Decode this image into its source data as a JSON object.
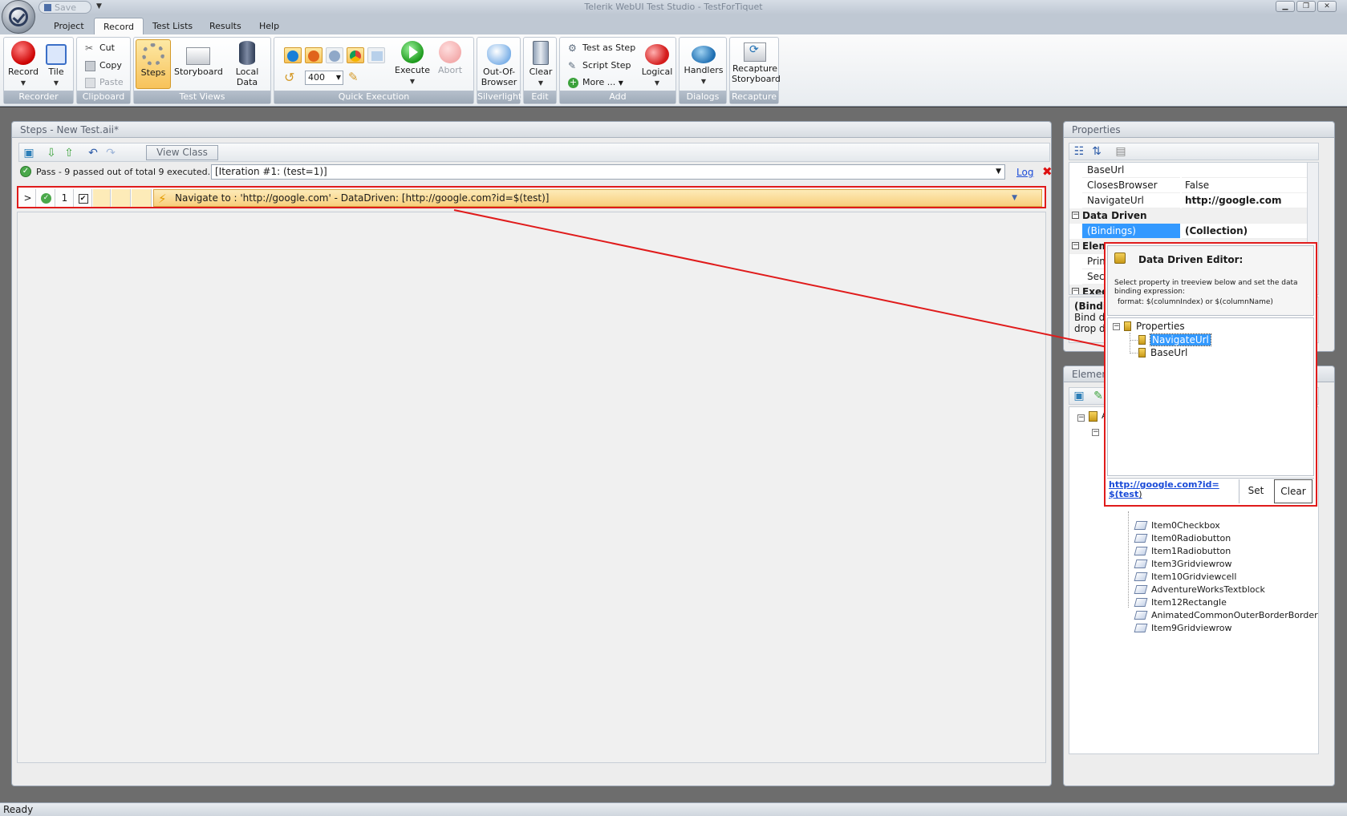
{
  "window": {
    "title": "Telerik WebUI Test Studio - TestForTiquet",
    "qat_save": "Save"
  },
  "tabs": [
    "Project",
    "Record",
    "Test Lists",
    "Results",
    "Help"
  ],
  "ribbon": {
    "recorder": {
      "label": "Recorder",
      "record": "Record",
      "tile": "Tile"
    },
    "clipboard": {
      "label": "Clipboard",
      "cut": "Cut",
      "copy": "Copy",
      "paste": "Paste"
    },
    "test_views": {
      "label": "Test Views",
      "steps": "Steps",
      "storyboard": "Storyboard",
      "local_data": "Local Data"
    },
    "quick_execution": {
      "label": "Quick Execution",
      "speed": "400",
      "execute": "Execute",
      "abort": "Abort"
    },
    "silverlight": {
      "label": "Silverlight",
      "oob_1": "Out-Of-",
      "oob_2": "Browser"
    },
    "edit": {
      "label": "Edit",
      "clear": "Clear"
    },
    "add": {
      "label": "Add",
      "test_as_step": "Test as Step",
      "script_step": "Script Step",
      "more": "More ...",
      "logical": "Logical"
    },
    "dialogs": {
      "label": "Dialogs",
      "handlers": "Handlers"
    },
    "recapture": {
      "label": "Recapture",
      "recapture_1": "Recapture",
      "recapture_2": "Storyboard"
    }
  },
  "steps_panel": {
    "title": "Steps - New Test.aii*",
    "view_class": "View Class",
    "status": "Pass - 9 passed out of total 9 executed.",
    "iteration": "[Iteration #1: (test=1)]",
    "log": "Log",
    "step": {
      "expander": ">",
      "number": "1",
      "description": "Navigate to : 'http://google.com' - DataDriven: [http://google.com?id=$(test)]"
    }
  },
  "properties_panel": {
    "title": "Properties",
    "rows": [
      {
        "key": "BaseUrl",
        "value": ""
      },
      {
        "key": "ClosesBrowser",
        "value": "False"
      },
      {
        "key": "NavigateUrl",
        "value": "http://google.com"
      }
    ],
    "category_data_driven": "Data Driven",
    "bindings_key": "(Bindings)",
    "bindings_value": "(Collection)",
    "category_element": "Elem",
    "primary": "Prima",
    "secondary": "Seco",
    "category_exec": "Exec",
    "desc_title": "(Bindin",
    "desc_line1": "Bind da",
    "desc_line2": "drop do"
  },
  "elements_panel": {
    "title": "Elemen",
    "root_prefix": "A",
    "items": [
      "Item0Checkbox",
      "Item0Radiobutton",
      "Item1Radiobutton",
      "Item3Gridviewrow",
      "Item10Gridviewcell",
      "AdventureWorksTextblock",
      "Item12Rectangle",
      "AnimatedCommonOuterBorderBorder",
      "Item9Gridviewrow"
    ]
  },
  "data_driven_editor": {
    "title": "Data Driven Editor:",
    "instructions": "Select property in treeview below and set the data binding expression:",
    "format": "format:  $(columnIndex) or $(columnName)",
    "tree_root": "Properties",
    "tree_items": [
      "NavigateUrl",
      "BaseUrl"
    ],
    "expression_line1": "http://google.com?id=",
    "expression_line2": "$(test",
    "expression_suffix": ")",
    "set": "Set",
    "clear": "Clear"
  },
  "statusbar": {
    "text": "Ready"
  },
  "colors": {
    "highlight": "#e01b1b",
    "selection": "#3399ff",
    "link": "#1a4bd8"
  }
}
